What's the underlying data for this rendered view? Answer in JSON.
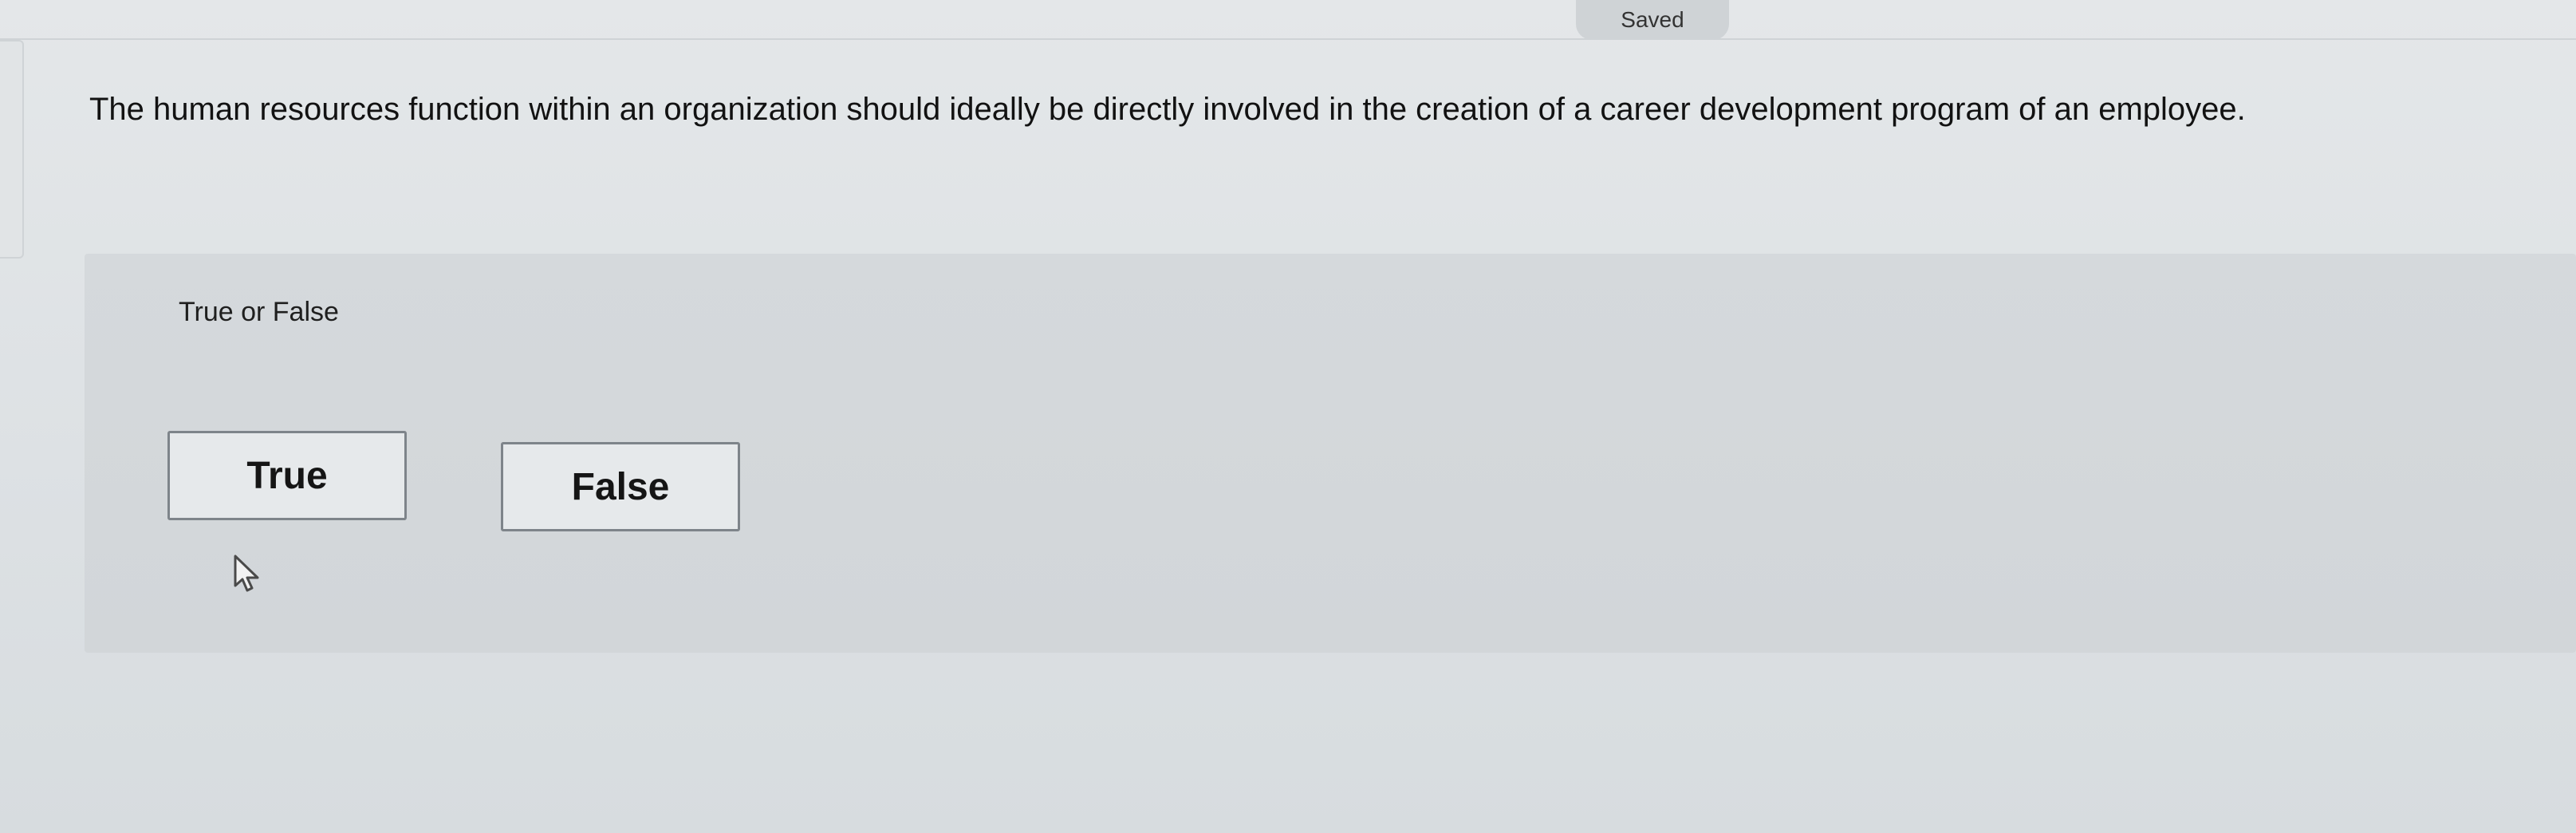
{
  "status": {
    "saved_label": "Saved"
  },
  "question": {
    "text": "The human resources function within an organization should ideally be directly involved in the creation of a career development program of an employee.",
    "prompt": "True or False",
    "options": [
      {
        "label": "True"
      },
      {
        "label": "False"
      }
    ]
  },
  "colors": {
    "background": "#dde1e4",
    "panel": "#d4d8db",
    "button_border": "#7e848a"
  },
  "icons": {
    "cursor": "mouse-pointer-icon"
  }
}
